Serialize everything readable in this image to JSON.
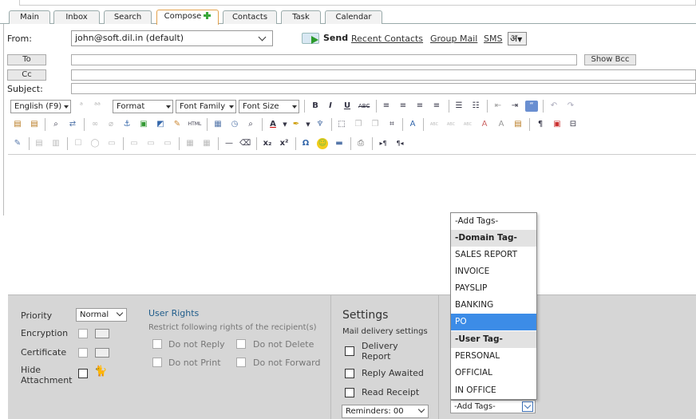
{
  "tabs": [
    {
      "label": "Main"
    },
    {
      "label": "Inbox"
    },
    {
      "label": "Search"
    },
    {
      "label": "Compose"
    },
    {
      "label": "Contacts"
    },
    {
      "label": "Task"
    },
    {
      "label": "Calendar"
    }
  ],
  "from": {
    "label": "From:",
    "value": "john@soft.dil.in (default)"
  },
  "actions": {
    "send": "Send",
    "recent_contacts": "Recent Contacts",
    "group_mail": "Group Mail",
    "sms": "SMS",
    "language": "अ"
  },
  "recipients": {
    "to": "To",
    "cc": "Cc",
    "subject": "Subject:",
    "show_bcc": "Show Bcc"
  },
  "toolbar": {
    "language": "English (F9)",
    "format": "Format",
    "font_family": "Font Family",
    "font_size": "Font Size",
    "bold": "B",
    "italic": "I",
    "underline": "U",
    "strike": "ABC",
    "omega": "Ω",
    "subscript": "x₂",
    "superscript": "x²",
    "html": "HTML",
    "font_color": "A",
    "pilcrow": "¶"
  },
  "options": {
    "priority_label": "Priority",
    "priority_value": "Normal",
    "encryption": "Encryption",
    "certificate": "Certificate",
    "hide_attachment": "Hide Attachment"
  },
  "user_rights": {
    "title": "User Rights",
    "subtitle": "Restrict following rights of the recipient(s)",
    "items": [
      "Do not Reply",
      "Do not Delete",
      "Do not Print",
      "Do not Forward"
    ]
  },
  "settings": {
    "title": "Settings",
    "subtitle": "Mail delivery settings",
    "delivery_report": "Delivery Report",
    "reply_awaited": "Reply Awaited",
    "read_receipt": "Read Receipt",
    "reminders": "Reminders: 00"
  },
  "tags": {
    "select_value": "-Add Tags-",
    "options": [
      "-Add Tags-",
      "-Domain Tag-",
      "SALES REPORT",
      "INVOICE",
      "PAYSLIP",
      "BANKING",
      "PO",
      "-User Tag-",
      "PERSONAL",
      "OFFICIAL",
      "IN OFFICE"
    ],
    "selected": "PO",
    "headers": [
      "-Domain Tag-",
      "-User Tag-"
    ]
  },
  "colors": {
    "accent": "#3c8ce7",
    "active_tab_border": "#e3a14b",
    "panel_bg": "#d6d6d6",
    "rights_title": "#1f5c8a"
  }
}
